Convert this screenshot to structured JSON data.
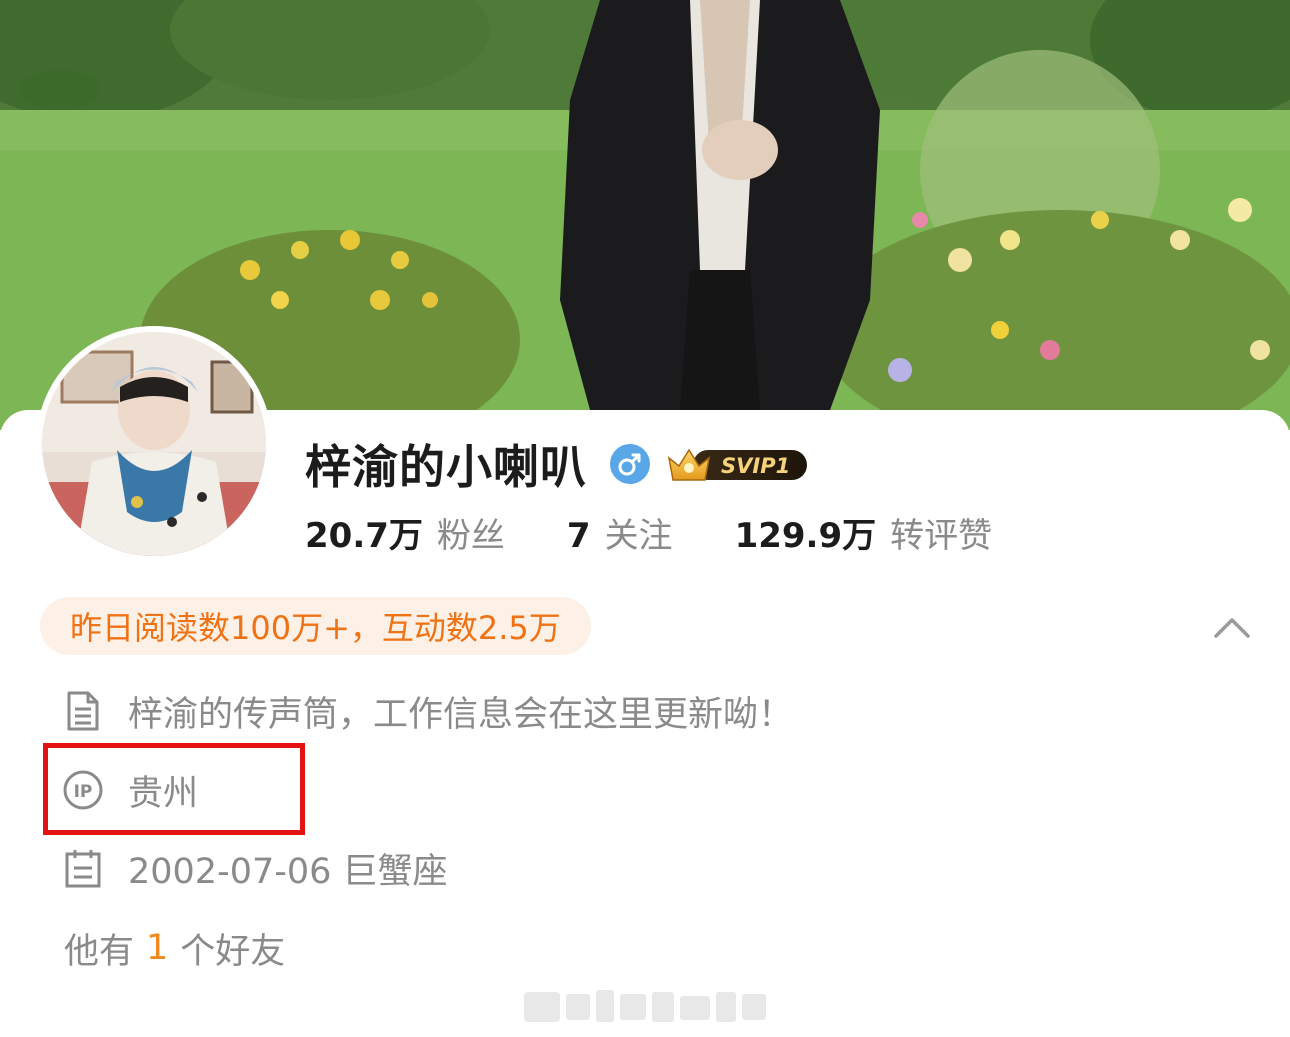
{
  "profile": {
    "name": "梓渝的小喇叭",
    "gender_icon": "male-symbol-icon",
    "vip_badge": "SVIP1",
    "stats": [
      {
        "value": "20.7万",
        "label": "粉丝"
      },
      {
        "value": "7",
        "label": "关注"
      },
      {
        "value": "129.9万",
        "label": "转评赞"
      }
    ],
    "highlight_pill": "昨日阅读数100万+，互动数2.5万",
    "bio": "梓渝的传声筒，工作信息会在这里更新呦！",
    "ip_location": "贵州",
    "birthday": "2002-07-06 巨蟹座",
    "friends_prefix": "他有",
    "friends_count": "1",
    "friends_suffix": "个好友"
  },
  "icons": {
    "collapse": "chevron-up-icon",
    "bio": "document-icon",
    "ip": "ip-location-icon",
    "birthday": "calendar-icon"
  },
  "colors": {
    "accent_orange": "#ef7215",
    "pill_bg": "#fdf0e6",
    "gender_blue": "#59a7e6",
    "highlight_red": "#e41212",
    "muted_text": "#8a8a8a"
  }
}
